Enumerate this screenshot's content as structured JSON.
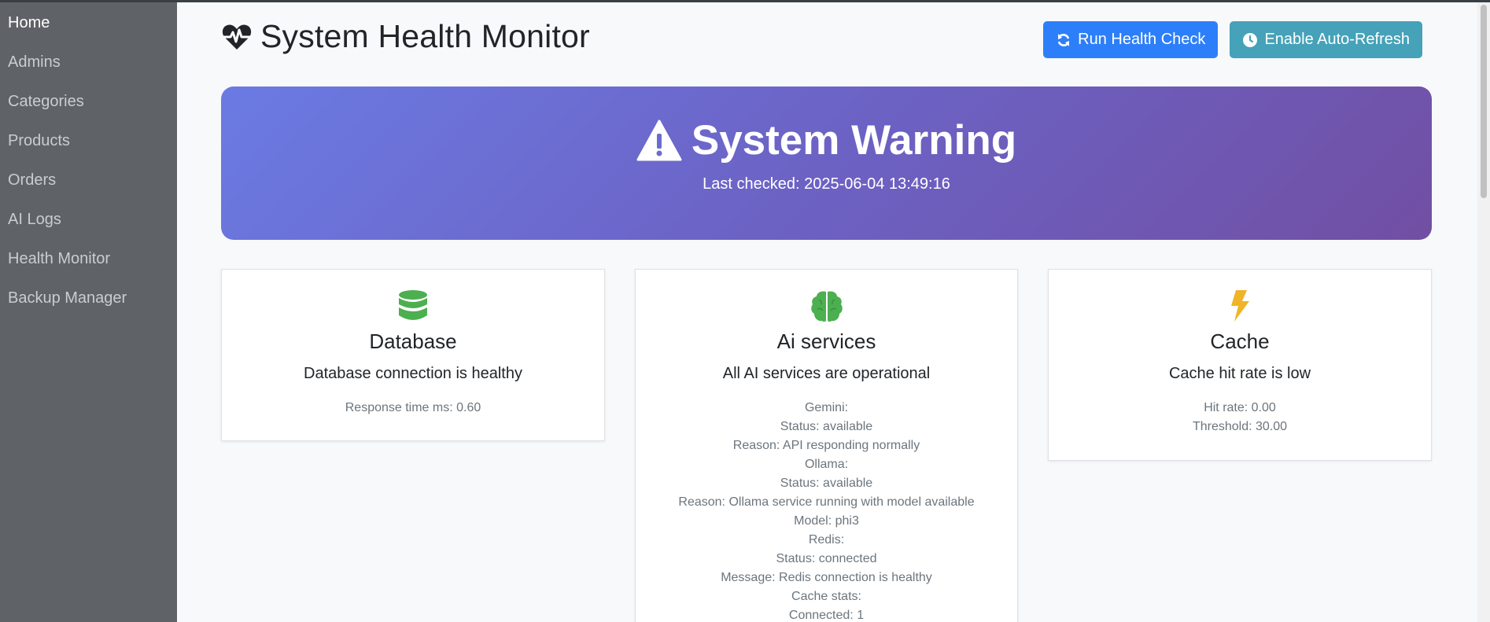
{
  "sidebar": {
    "items": [
      {
        "label": "Home"
      },
      {
        "label": "Admins"
      },
      {
        "label": "Categories"
      },
      {
        "label": "Products"
      },
      {
        "label": "Orders"
      },
      {
        "label": "AI Logs"
      },
      {
        "label": "Health Monitor"
      },
      {
        "label": "Backup Manager"
      }
    ]
  },
  "header": {
    "title": "System Health Monitor",
    "icon": "heartbeat-icon",
    "run_label": "Run Health Check",
    "auto_label": "Enable Auto-Refresh"
  },
  "banner": {
    "title": "System Warning",
    "last_checked": "Last checked: 2025-06-04 13:49:16",
    "icon": "warning-triangle-icon"
  },
  "cards": {
    "database": {
      "title": "Database",
      "message": "Database connection is healthy",
      "details": [
        "Response time ms: 0.60"
      ],
      "icon": "database-icon",
      "icon_color": "#4caf50"
    },
    "ai": {
      "title": "Ai services",
      "message": "All AI services are operational",
      "details": [
        "Gemini:",
        "Status: available",
        "Reason: API responding normally",
        "Ollama:",
        "Status: available",
        "Reason: Ollama service running with model available",
        "Model: phi3",
        "Redis:",
        "Status: connected",
        "Message: Redis connection is healthy",
        "Cache stats:",
        "Connected: 1"
      ],
      "icon": "brain-icon",
      "icon_color": "#4caf50"
    },
    "cache": {
      "title": "Cache",
      "message": "Cache hit rate is low",
      "details": [
        "Hit rate: 0.00",
        "Threshold: 30.00"
      ],
      "icon": "bolt-icon",
      "icon_color": "#f0b429"
    }
  },
  "colors": {
    "sidebar_bg": "#5f6368",
    "primary": "#2d7ff9",
    "info": "#45a2b8",
    "banner_start": "#6b7be3",
    "banner_end": "#714fa3"
  }
}
